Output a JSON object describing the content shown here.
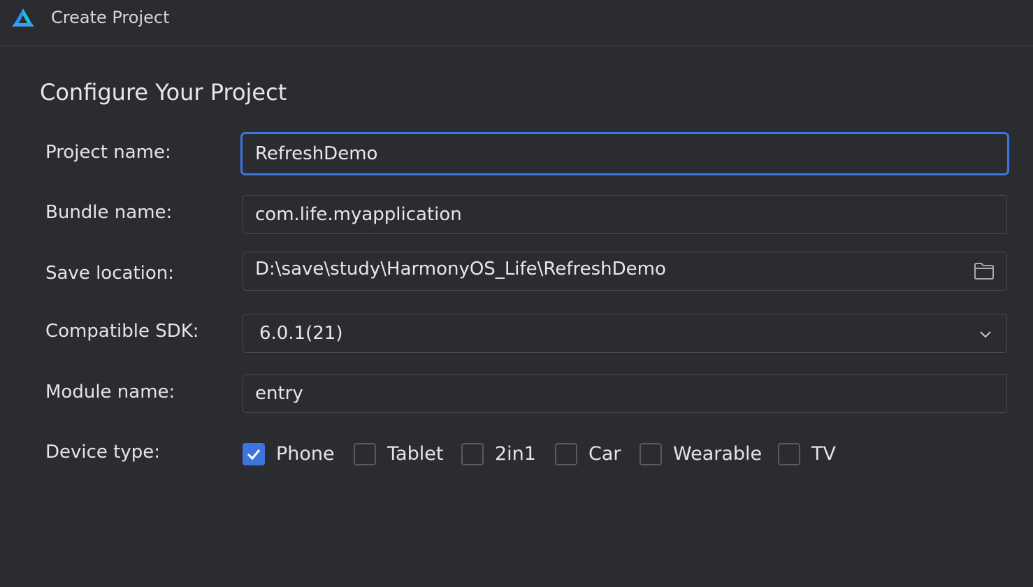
{
  "window": {
    "title": "Create Project"
  },
  "section": {
    "title": "Configure Your Project"
  },
  "form": {
    "project_name": {
      "label": "Project name:",
      "value": "RefreshDemo"
    },
    "bundle_name": {
      "label": "Bundle name:",
      "value": "com.life.myapplication"
    },
    "save_location": {
      "label": "Save location:",
      "value": "D:\\save\\study\\HarmonyOS_Life\\RefreshDemo"
    },
    "compatible_sdk": {
      "label": "Compatible SDK:",
      "value": "6.0.1(21)"
    },
    "module_name": {
      "label": "Module name:",
      "value": "entry"
    },
    "device_type": {
      "label": "Device type:",
      "options": [
        {
          "label": "Phone",
          "checked": true
        },
        {
          "label": "Tablet",
          "checked": false
        },
        {
          "label": "2in1",
          "checked": false
        },
        {
          "label": "Car",
          "checked": false
        },
        {
          "label": "Wearable",
          "checked": false
        },
        {
          "label": "TV",
          "checked": false
        }
      ]
    }
  },
  "icons": {
    "app_logo": "harmonyos-devstudio-logo-icon",
    "folder": "folder-icon",
    "chevron": "chevron-down-icon",
    "check": "checkmark-icon"
  },
  "colors": {
    "background": "#2b2c30",
    "accent": "#3d74e0",
    "border": "#4b4c52",
    "text": "#e3e4e8"
  }
}
